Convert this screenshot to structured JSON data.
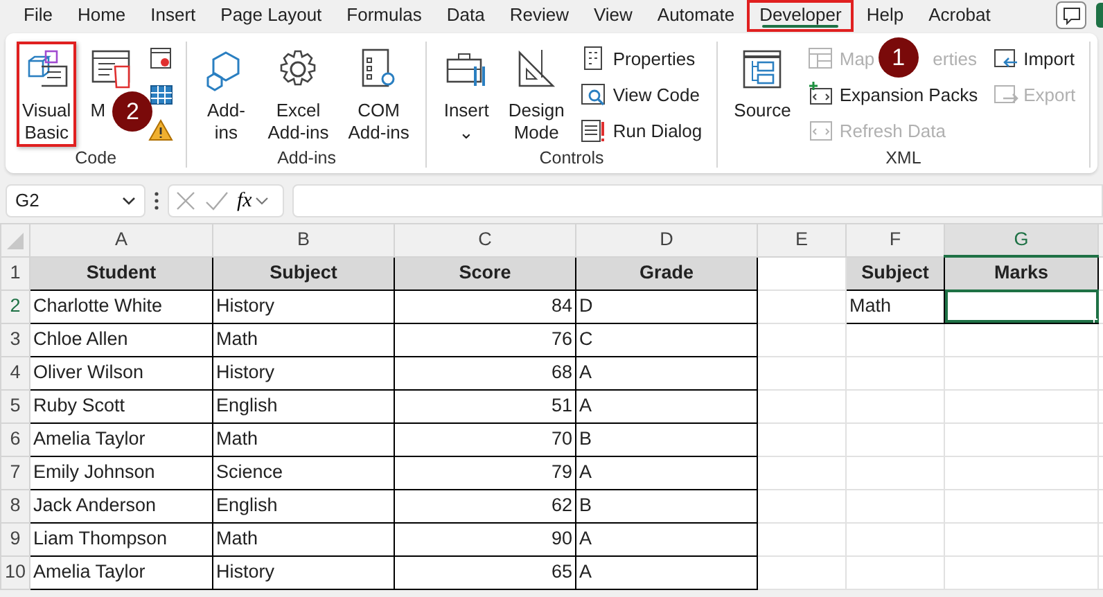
{
  "menu_tabs": [
    {
      "label": "File",
      "selected": false,
      "highlighted": false
    },
    {
      "label": "Home",
      "selected": false,
      "highlighted": false
    },
    {
      "label": "Insert",
      "selected": false,
      "highlighted": false
    },
    {
      "label": "Page Layout",
      "selected": false,
      "highlighted": false
    },
    {
      "label": "Formulas",
      "selected": false,
      "highlighted": false
    },
    {
      "label": "Data",
      "selected": false,
      "highlighted": false
    },
    {
      "label": "Review",
      "selected": false,
      "highlighted": false
    },
    {
      "label": "View",
      "selected": false,
      "highlighted": false
    },
    {
      "label": "Automate",
      "selected": false,
      "highlighted": false
    },
    {
      "label": "Developer",
      "selected": true,
      "highlighted": true
    },
    {
      "label": "Help",
      "selected": false,
      "highlighted": false
    },
    {
      "label": "Acrobat",
      "selected": false,
      "highlighted": false
    }
  ],
  "ribbon_groups": [
    {
      "title": "Code",
      "columns": [
        {
          "kind": "large",
          "items": [
            {
              "label_lines": [
                "Visual",
                "Basic"
              ],
              "highlighted": true,
              "disabled": false
            }
          ]
        },
        {
          "kind": "large",
          "items": [
            {
              "label_lines": [
                "M"
              ],
              "highlighted": false,
              "disabled": false,
              "badge": "2"
            }
          ]
        },
        {
          "kind": "icons",
          "items": [
            {
              "disabled": false
            },
            {
              "disabled": false
            },
            {
              "disabled": false
            }
          ]
        }
      ]
    },
    {
      "title": "Add-ins",
      "columns": [
        {
          "kind": "large",
          "items": [
            {
              "label_lines": [
                "Add-",
                "ins"
              ],
              "highlighted": false,
              "disabled": false
            }
          ]
        },
        {
          "kind": "large",
          "items": [
            {
              "label_lines": [
                "Excel",
                "Add-ins"
              ],
              "highlighted": false,
              "disabled": false
            }
          ]
        },
        {
          "kind": "large",
          "items": [
            {
              "label_lines": [
                "COM",
                "Add-ins"
              ],
              "highlighted": false,
              "disabled": false
            }
          ]
        }
      ]
    },
    {
      "title": "Controls",
      "columns": [
        {
          "kind": "large",
          "items": [
            {
              "label_lines": [
                "Insert",
                "⌄"
              ],
              "highlighted": false,
              "disabled": false
            }
          ]
        },
        {
          "kind": "large",
          "items": [
            {
              "label_lines": [
                "Design",
                "Mode"
              ],
              "highlighted": false,
              "disabled": false
            }
          ]
        },
        {
          "kind": "small",
          "items": [
            {
              "label": "Properties",
              "disabled": false
            },
            {
              "label": "View Code",
              "disabled": false
            },
            {
              "label": "Run Dialog",
              "disabled": false
            }
          ]
        }
      ]
    },
    {
      "title": "XML",
      "columns": [
        {
          "kind": "large",
          "items": [
            {
              "label_lines": [
                "Source"
              ],
              "highlighted": false,
              "disabled": false
            }
          ]
        },
        {
          "kind": "small",
          "items": [
            {
              "label": "Map",
              "label_rest": "erties",
              "disabled": true,
              "badge": "1"
            },
            {
              "label": "Expansion Packs",
              "disabled": false
            },
            {
              "label": "Refresh Data",
              "disabled": true
            }
          ]
        },
        {
          "kind": "small",
          "items": [
            {
              "label": "Import",
              "disabled": false
            },
            {
              "label": "Export",
              "disabled": true
            }
          ]
        }
      ]
    }
  ],
  "formula_bar": {
    "name_box": "G2",
    "fx": "fx"
  },
  "sheet": {
    "columns": [
      {
        "label": "A",
        "selected": false
      },
      {
        "label": "B",
        "selected": false
      },
      {
        "label": "C",
        "selected": false
      },
      {
        "label": "D",
        "selected": false
      },
      {
        "label": "E",
        "selected": false
      },
      {
        "label": "F",
        "selected": false
      },
      {
        "label": "G",
        "selected": true
      }
    ],
    "rows": [
      {
        "number": "1",
        "selected": false,
        "cells": [
          "Student",
          "Subject",
          "Score",
          "Grade",
          "",
          "Subject",
          "Marks"
        ]
      },
      {
        "number": "2",
        "selected": true,
        "cells": [
          "Charlotte White",
          "History",
          "84",
          "D",
          "",
          "Math",
          ""
        ]
      },
      {
        "number": "3",
        "selected": false,
        "cells": [
          "Chloe Allen",
          "Math",
          "76",
          "C",
          "",
          "",
          ""
        ]
      },
      {
        "number": "4",
        "selected": false,
        "cells": [
          "Oliver Wilson",
          "History",
          "68",
          "A",
          "",
          "",
          ""
        ]
      },
      {
        "number": "5",
        "selected": false,
        "cells": [
          "Ruby Scott",
          "English",
          "51",
          "A",
          "",
          "",
          ""
        ]
      },
      {
        "number": "6",
        "selected": false,
        "cells": [
          "Amelia Taylor",
          "Math",
          "70",
          "B",
          "",
          "",
          ""
        ]
      },
      {
        "number": "7",
        "selected": false,
        "cells": [
          "Emily Johnson",
          "Science",
          "79",
          "A",
          "",
          "",
          ""
        ]
      },
      {
        "number": "8",
        "selected": false,
        "cells": [
          "Jack Anderson",
          "English",
          "62",
          "B",
          "",
          "",
          ""
        ]
      },
      {
        "number": "9",
        "selected": false,
        "cells": [
          "Liam Thompson",
          "Math",
          "90",
          "A",
          "",
          "",
          ""
        ]
      },
      {
        "number": "10",
        "selected": false,
        "cells": [
          "Amelia Taylor",
          "History",
          "65",
          "A",
          "",
          "",
          ""
        ]
      }
    ]
  }
}
